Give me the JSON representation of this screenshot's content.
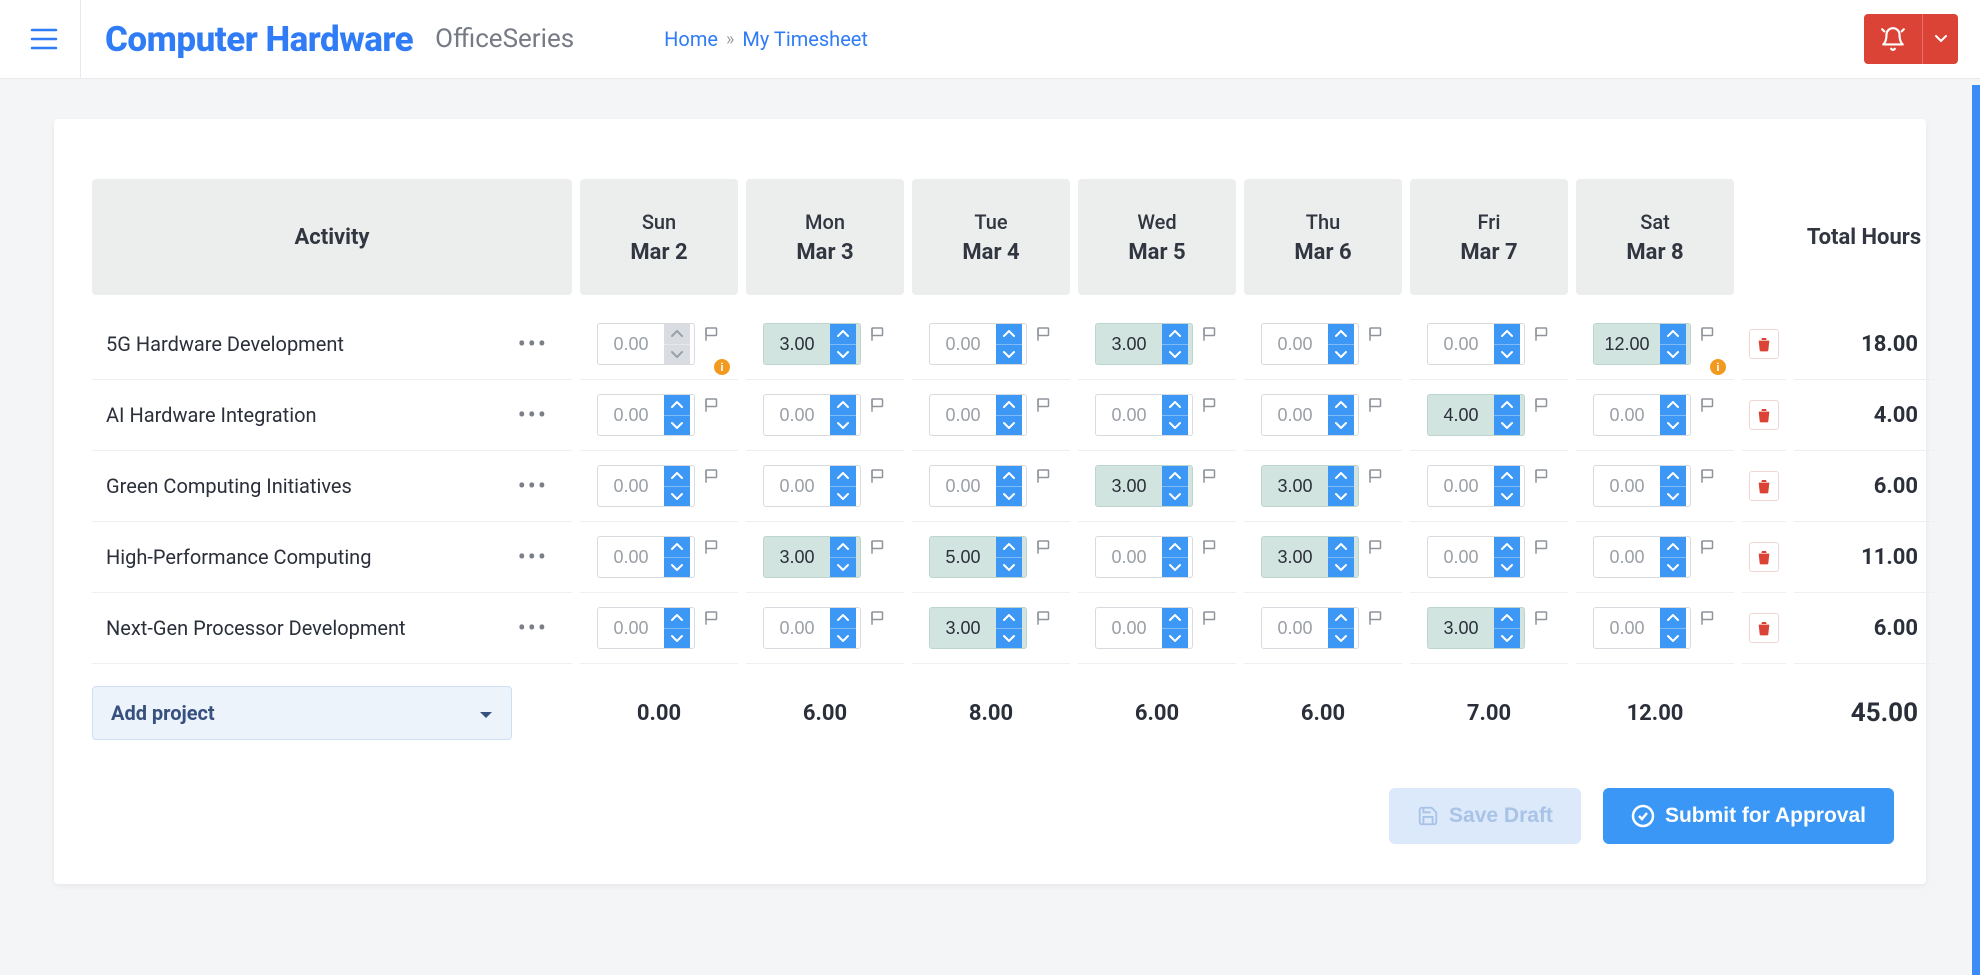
{
  "header": {
    "brand": "Computer Hardware",
    "subbrand": "OfficeSeries",
    "breadcrumb_home": "Home",
    "breadcrumb_current": "My Timesheet"
  },
  "columns": {
    "activity": "Activity",
    "total": "Total Hours",
    "days": [
      {
        "dow": "Sun",
        "date": "Mar 2"
      },
      {
        "dow": "Mon",
        "date": "Mar 3"
      },
      {
        "dow": "Tue",
        "date": "Mar 4"
      },
      {
        "dow": "Wed",
        "date": "Mar 5"
      },
      {
        "dow": "Thu",
        "date": "Mar 6"
      },
      {
        "dow": "Fri",
        "date": "Mar 7"
      },
      {
        "dow": "Sat",
        "date": "Mar 8"
      }
    ]
  },
  "rows": [
    {
      "name": "5G Hardware Development",
      "hours": [
        {
          "v": "0.00",
          "filled": false,
          "disabled_spin": true,
          "warn": true
        },
        {
          "v": "3.00",
          "filled": true
        },
        {
          "v": "0.00",
          "filled": false
        },
        {
          "v": "3.00",
          "filled": true
        },
        {
          "v": "0.00",
          "filled": false
        },
        {
          "v": "0.00",
          "filled": false
        },
        {
          "v": "12.00",
          "filled": true,
          "warn": true
        }
      ],
      "total": "18.00"
    },
    {
      "name": "AI Hardware Integration",
      "hours": [
        {
          "v": "0.00"
        },
        {
          "v": "0.00"
        },
        {
          "v": "0.00"
        },
        {
          "v": "0.00"
        },
        {
          "v": "0.00"
        },
        {
          "v": "4.00",
          "filled": true
        },
        {
          "v": "0.00"
        }
      ],
      "total": "4.00"
    },
    {
      "name": "Green Computing Initiatives",
      "hours": [
        {
          "v": "0.00"
        },
        {
          "v": "0.00"
        },
        {
          "v": "0.00"
        },
        {
          "v": "3.00",
          "filled": true
        },
        {
          "v": "3.00",
          "filled": true
        },
        {
          "v": "0.00"
        },
        {
          "v": "0.00"
        }
      ],
      "total": "6.00"
    },
    {
      "name": "High-Performance Computing",
      "hours": [
        {
          "v": "0.00"
        },
        {
          "v": "3.00",
          "filled": true
        },
        {
          "v": "5.00",
          "filled": true
        },
        {
          "v": "0.00"
        },
        {
          "v": "3.00",
          "filled": true
        },
        {
          "v": "0.00"
        },
        {
          "v": "0.00"
        }
      ],
      "total": "11.00"
    },
    {
      "name": "Next-Gen Processor Development",
      "hours": [
        {
          "v": "0.00"
        },
        {
          "v": "0.00"
        },
        {
          "v": "3.00",
          "filled": true
        },
        {
          "v": "0.00"
        },
        {
          "v": "0.00"
        },
        {
          "v": "3.00",
          "filled": true
        },
        {
          "v": "0.00"
        }
      ],
      "total": "6.00"
    }
  ],
  "footer": {
    "add_project": "Add project",
    "day_totals": [
      "0.00",
      "6.00",
      "8.00",
      "6.00",
      "6.00",
      "7.00",
      "12.00"
    ],
    "grand_total": "45.00"
  },
  "actions": {
    "save_draft": "Save Draft",
    "submit": "Submit for Approval"
  }
}
